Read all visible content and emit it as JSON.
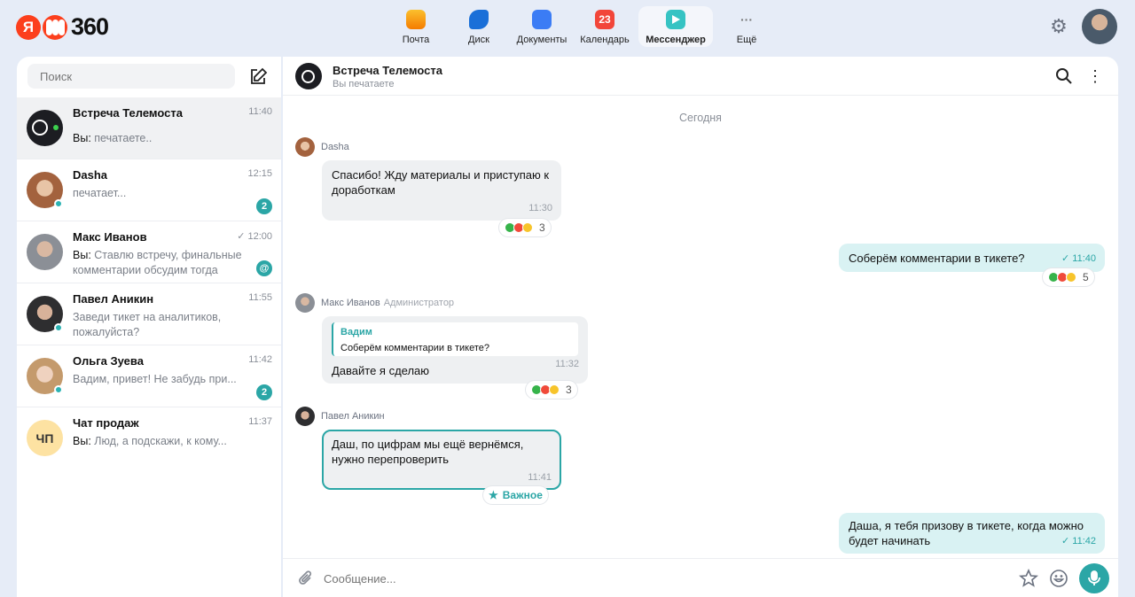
{
  "brand": {
    "ya": "Я",
    "name": "360"
  },
  "apps": [
    {
      "label": "Почта",
      "icon": "mail-icon",
      "color": "#f6a623"
    },
    {
      "label": "Диск",
      "icon": "disk-icon",
      "color": "#1a6fd8"
    },
    {
      "label": "Документы",
      "icon": "documents-icon",
      "color": "#3b7cf5"
    },
    {
      "label": "Календарь",
      "icon": "calendar-icon",
      "color": "#f2463a",
      "badge": "23"
    },
    {
      "label": "Мессенджер",
      "icon": "messenger-icon",
      "color": "#36c3c3",
      "active": true
    },
    {
      "label": "Ещё",
      "icon": "more-apps-icon"
    }
  ],
  "sidebar": {
    "search_placeholder": "Поиск",
    "chats": [
      {
        "name": "Встреча Телемоста",
        "time": "11:40",
        "you": "Вы:",
        "preview": "печатаете..",
        "avatar": "telemost-avatar",
        "active": true
      },
      {
        "name": "Dasha",
        "time": "12:15",
        "preview": "печатает...",
        "badge": "2",
        "online": true,
        "avatar": "dasha-avatar"
      },
      {
        "name": "Макс Иванов",
        "time": "12:00",
        "you": "Вы:",
        "preview": "Ставлю встречу, финальные комментарии обсудим тогда",
        "badge": "@",
        "avatar": "maks-avatar",
        "read": true
      },
      {
        "name": "Павел Аникин",
        "time": "11:55",
        "preview": "Заведи тикет на аналитиков, пожалуйста?",
        "online": true,
        "avatar": "pavel-avatar"
      },
      {
        "name": "Ольга Зуева",
        "time": "11:42",
        "preview": "Вадим, привет! Не забудь при...",
        "badge": "2",
        "online": true,
        "avatar": "olga-avatar"
      },
      {
        "name": "Чат продаж",
        "time": "11:37",
        "you": "Вы:",
        "preview": "Люд, а подскажи, к кому...",
        "initials": "ЧП",
        "avatar": "sales-chat-avatar"
      }
    ]
  },
  "header": {
    "title": "Встреча Телемоста",
    "subtitle": "Вы печатаете"
  },
  "day_label": "Сегодня",
  "messages": {
    "m1": {
      "sender": "Dasha",
      "text": "Спасибо! Жду материалы и приступаю к доработкам",
      "time": "11:30",
      "reactions": "3"
    },
    "m2": {
      "text": "Соберём комментарии в тикете?",
      "time": "11:40",
      "reactions": "5"
    },
    "m3": {
      "sender": "Макс Иванов",
      "role": "Администратор",
      "quote_name": "Вадим",
      "quote_text": "Соберём комментарии в тикете?",
      "text": "Давайте я сделаю",
      "time": "11:32",
      "reactions": "3"
    },
    "m4": {
      "sender": "Павел Аникин",
      "text": "Даш, по цифрам мы ещё вернёмся, нужно перепроверить",
      "time": "11:41",
      "tag": "Важное"
    },
    "m5": {
      "text": "Даша, я тебя призову в тикете, когда можно будет начинать",
      "time": "11:42"
    }
  },
  "composer": {
    "placeholder": "Сообщение..."
  },
  "colors": {
    "accent": "#2ba6a6",
    "brand": "#fc3f1d",
    "mine_bubble": "#d9f2f3"
  }
}
